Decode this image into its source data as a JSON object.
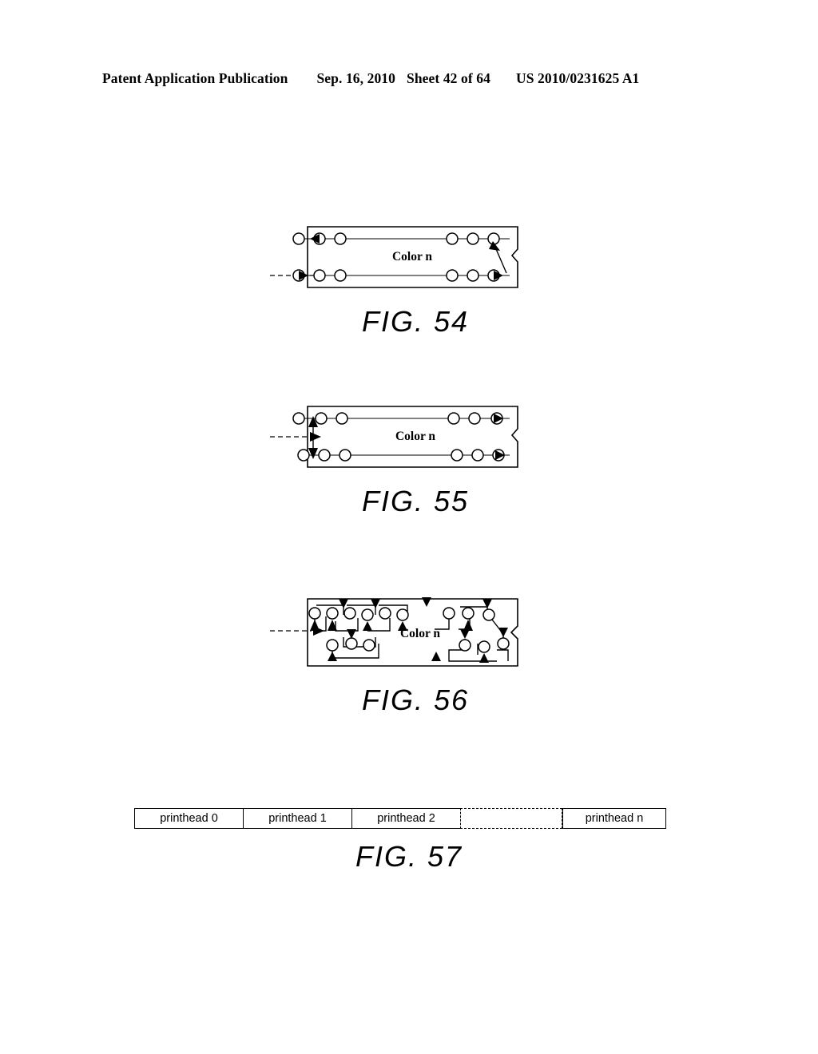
{
  "header": {
    "publication": "Patent Application Publication",
    "date": "Sep. 16, 2010",
    "sheet": "Sheet 42 of 64",
    "patent_number": "US 2010/0231625 A1"
  },
  "figures": [
    {
      "id": "fig54",
      "caption": "FIG. 54",
      "label": "Color n",
      "description": "printhead color channel with two nozzle rows, serpentine return path at right"
    },
    {
      "id": "fig55",
      "caption": "FIG. 55",
      "label": "Color n",
      "description": "printhead color channel with two nozzle rows fed from a common left riser"
    },
    {
      "id": "fig56",
      "caption": "FIG. 56",
      "label": "Color n",
      "description": "printhead color channel with interleaved staggered nozzle groups"
    },
    {
      "id": "fig57",
      "caption": "FIG. 57",
      "cells": [
        "printhead 0",
        "printhead 1",
        "printhead 2",
        "printhead n"
      ],
      "gap_label": ""
    }
  ]
}
